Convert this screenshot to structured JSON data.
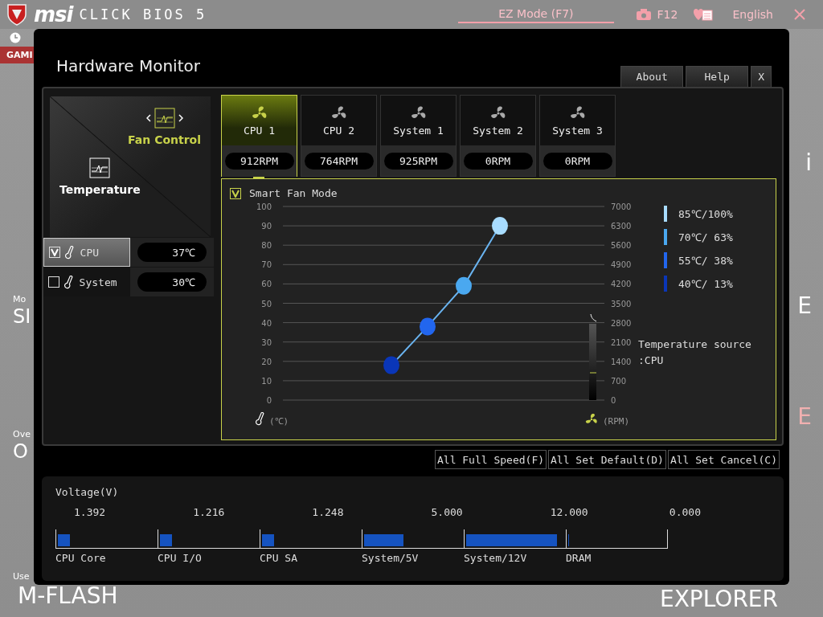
{
  "header": {
    "logo": "msi",
    "product": "CLICK BIOS 5",
    "mode_button": "EZ Mode (F7)",
    "screenshot_key": "F12",
    "language": "English"
  },
  "background": {
    "tab": "GAMI",
    "left_labels": [
      {
        "small": "Mo",
        "big": "SI"
      },
      {
        "small": "Ove",
        "big": "O"
      },
      {
        "small": "Use",
        "big": "M-FLASH"
      }
    ],
    "right_labels": [
      "i",
      "E",
      "E"
    ],
    "explorer": "EXPLORER"
  },
  "window": {
    "title": "Hardware Monitor",
    "buttons": [
      "About",
      "Help",
      "X"
    ]
  },
  "modes": [
    {
      "label": "Fan Control",
      "selected": true
    },
    {
      "label": "Temperature",
      "selected": false
    }
  ],
  "sensors": [
    {
      "name": "CPU",
      "checked": true,
      "selected": true,
      "value": "37℃"
    },
    {
      "name": "System",
      "checked": false,
      "selected": false,
      "value": "30℃"
    }
  ],
  "fans": [
    {
      "name": "CPU 1",
      "rpm": "912RPM",
      "selected": true
    },
    {
      "name": "CPU 2",
      "rpm": "764RPM",
      "selected": false
    },
    {
      "name": "System 1",
      "rpm": "925RPM",
      "selected": false
    },
    {
      "name": "System 2",
      "rpm": "0RPM",
      "selected": false
    },
    {
      "name": "System 3",
      "rpm": "0RPM",
      "selected": false
    }
  ],
  "smart_fan": {
    "label": "Smart Fan Mode",
    "checked": true
  },
  "temp_ticks": [
    "100",
    "90",
    "80",
    "70",
    "60",
    "50",
    "40",
    "30",
    "20",
    "10",
    "0"
  ],
  "rpm_ticks": [
    "7000",
    "6300",
    "5600",
    "4900",
    "4200",
    "3500",
    "2800",
    "2100",
    "1400",
    "700",
    "0"
  ],
  "x_unit": "(℃)",
  "y2_unit": "(RPM)",
  "legend": [
    {
      "label": "85℃/100%",
      "color": "#a8dcff"
    },
    {
      "label": "70℃/ 63%",
      "color": "#4aa8f0"
    },
    {
      "label": "55℃/ 38%",
      "color": "#2266ee"
    },
    {
      "label": "40℃/ 13%",
      "color": "#0a36b8"
    }
  ],
  "source_label": "Temperature source",
  "source_value": ":CPU",
  "actions": [
    "All Full Speed(F)",
    "All Set Default(D)",
    "All Set Cancel(C)"
  ],
  "voltage": {
    "title": "Voltage(V)",
    "rails": [
      {
        "name": "CPU Core",
        "value": "1.392",
        "level": 0.12
      },
      {
        "name": "CPU I/O",
        "value": "1.216",
        "level": 0.12
      },
      {
        "name": "CPU SA",
        "value": "1.248",
        "level": 0.12
      },
      {
        "name": "System/5V",
        "value": "5.000",
        "level": 0.4
      },
      {
        "name": "System/12V",
        "value": "12.000",
        "level": 0.92
      },
      {
        "name": "DRAM",
        "value": "0.000",
        "level": 0.01
      }
    ]
  }
}
